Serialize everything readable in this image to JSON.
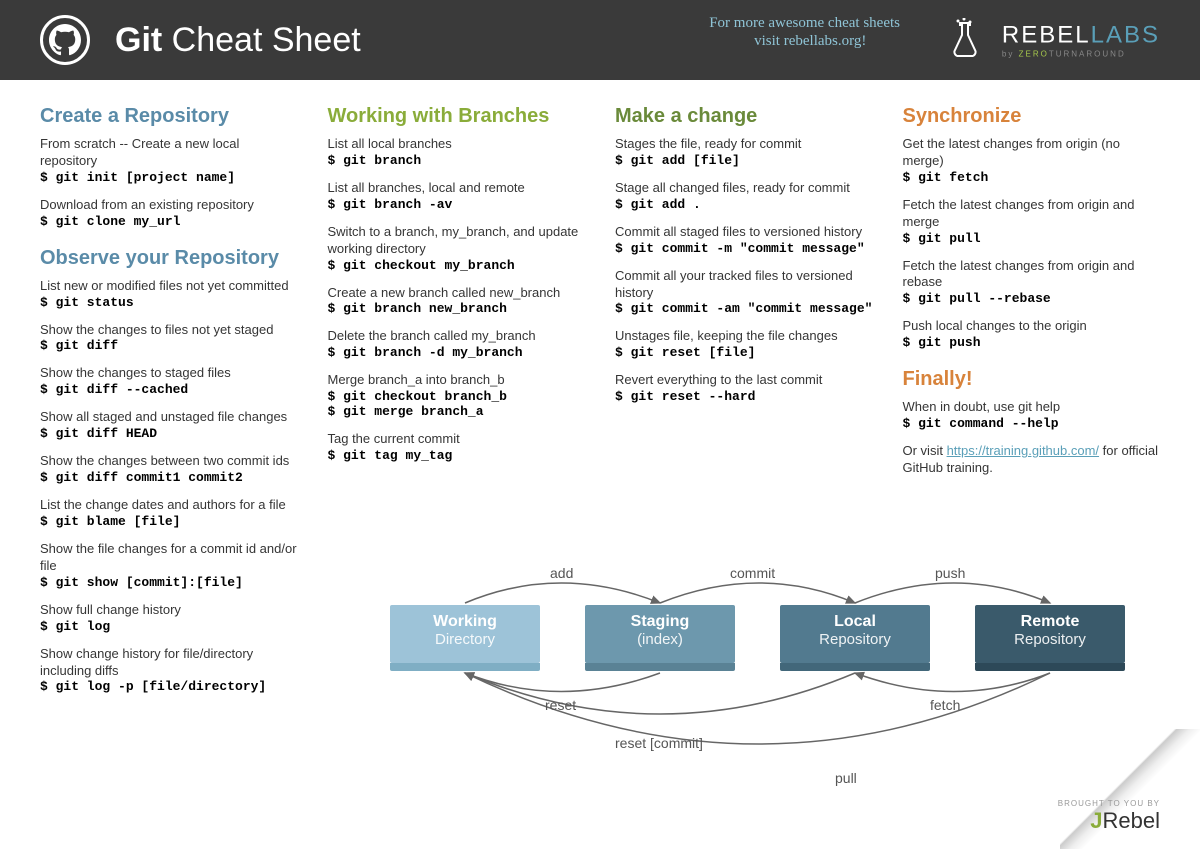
{
  "header": {
    "title_bold": "Git",
    "title_light": " Cheat Sheet",
    "promo": "For more awesome cheat sheets\n   visit rebellabs.org!",
    "brand_rebel": "REBEL",
    "brand_labs": "LABS",
    "brand_by": "by ",
    "brand_zero": "ZERO",
    "brand_turn": "TURNAROUND"
  },
  "sections": {
    "create": {
      "title": "Create a Repository",
      "items": [
        {
          "desc": "From scratch -- Create a new local repository",
          "cmd": "$ git init [project name]"
        },
        {
          "desc": "Download from an existing repository",
          "cmd": "$ git clone my_url"
        }
      ]
    },
    "observe": {
      "title": "Observe your Repository",
      "items": [
        {
          "desc": "List new or modified files not yet committed",
          "cmd": "$ git status"
        },
        {
          "desc": "Show the changes to files not yet staged",
          "cmd": "$ git diff"
        },
        {
          "desc": "Show the changes to staged files",
          "cmd": "$ git diff --cached"
        },
        {
          "desc": "Show all staged and unstaged file changes",
          "cmd": "$ git diff HEAD"
        },
        {
          "desc": "Show the changes between two commit ids",
          "cmd": "$ git diff commit1 commit2"
        },
        {
          "desc": "List the change dates and authors for a file",
          "cmd": "$ git blame [file]"
        },
        {
          "desc": "Show the file changes for a commit id and/or file",
          "cmd": "$ git show [commit]:[file]"
        },
        {
          "desc": "Show full change history",
          "cmd": "$ git log"
        },
        {
          "desc": "Show change history for file/directory including diffs",
          "cmd": "$ git log -p [file/directory]"
        }
      ]
    },
    "branches": {
      "title": "Working with Branches",
      "items": [
        {
          "desc": "List all local branches",
          "cmd": "$ git branch"
        },
        {
          "desc": "List all branches, local and remote",
          "cmd": "$ git branch -av"
        },
        {
          "desc": "Switch to a branch, my_branch, and update working directory",
          "cmd": "$ git checkout my_branch"
        },
        {
          "desc": "Create a new branch called new_branch",
          "cmd": "$ git branch new_branch"
        },
        {
          "desc": "Delete the branch called my_branch",
          "cmd": "$ git branch -d my_branch"
        },
        {
          "desc": "Merge branch_a into branch_b",
          "cmd": "$ git checkout branch_b\n$ git merge branch_a"
        },
        {
          "desc": "Tag the current commit",
          "cmd": "$ git tag my_tag"
        }
      ]
    },
    "change": {
      "title": "Make a change",
      "items": [
        {
          "desc": "Stages the file, ready for commit",
          "cmd": "$ git add [file]"
        },
        {
          "desc": "Stage all changed files, ready for commit",
          "cmd": "$ git add ."
        },
        {
          "desc": "Commit all staged files to versioned history",
          "cmd": "$ git commit -m \"commit message\""
        },
        {
          "desc": "Commit all your tracked files to versioned history",
          "cmd": "$ git commit -am \"commit message\""
        },
        {
          "desc": "Unstages file, keeping the file changes",
          "cmd": "$ git reset [file]"
        },
        {
          "desc": "Revert everything to the last commit",
          "cmd": "$ git reset --hard"
        }
      ]
    },
    "sync": {
      "title": "Synchronize",
      "items": [
        {
          "desc": "Get the latest changes from origin (no merge)",
          "cmd": "$ git fetch"
        },
        {
          "desc": "Fetch the latest changes from origin and merge",
          "cmd": "$ git pull"
        },
        {
          "desc": "Fetch the latest changes from origin and rebase",
          "cmd": "$ git pull --rebase"
        },
        {
          "desc": "Push local changes to the origin",
          "cmd": "$ git push"
        }
      ]
    },
    "finally": {
      "title": "Finally!",
      "desc1": "When in doubt, use git help",
      "cmd1": "$ git command --help",
      "desc2a": "Or visit ",
      "link": "https://training.github.com/",
      "desc2b": " for official GitHub training."
    }
  },
  "diagram": {
    "boxes": {
      "working": {
        "t1": "Working",
        "t2": "Directory"
      },
      "staging": {
        "t1": "Staging",
        "t2": "(index)"
      },
      "local": {
        "t1": "Local",
        "t2": "Repository"
      },
      "remote": {
        "t1": "Remote",
        "t2": "Repository"
      }
    },
    "labels": {
      "add": "add",
      "commit": "commit",
      "push": "push",
      "reset": "reset",
      "reset_commit": "reset [commit]",
      "fetch": "fetch",
      "pull": "pull"
    }
  },
  "footer": {
    "brought": "BROUGHT TO YOU BY",
    "j": "J",
    "rebel": "Rebel"
  }
}
